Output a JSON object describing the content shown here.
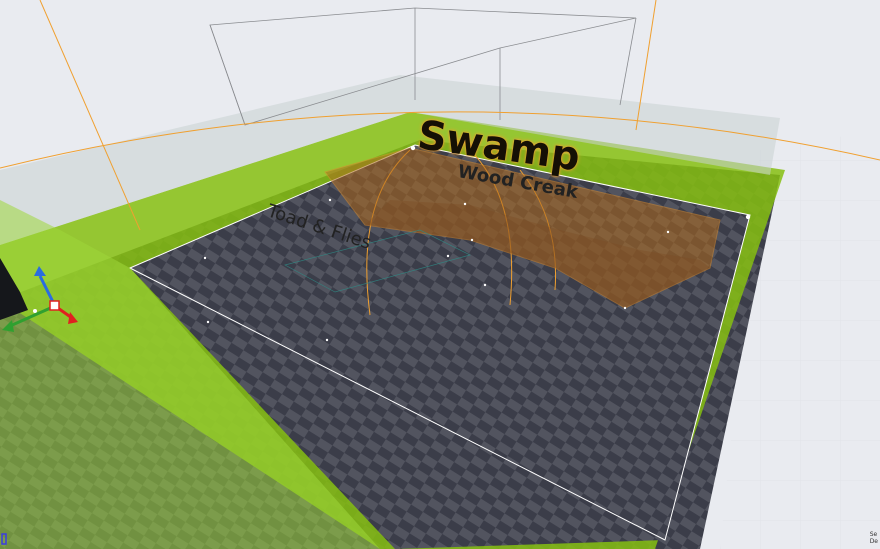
{
  "viewport": {
    "labels": {
      "swamp": "Swamp",
      "wood_creak": "Wood Creak",
      "toad_flies": "Toad &  Flies"
    },
    "corner_stats": [
      "Se",
      "De"
    ],
    "colors": {
      "background": "#e9ebf0",
      "floor_dark": "#3b3d49",
      "floor_light": "#52545f",
      "ambient_volume": "#86c010",
      "reverb_volume": "#b06a1c",
      "orange_line": "#f0a030",
      "gizmo_x": "#e02020",
      "gizmo_y": "#30a030",
      "gizmo_z": "#2a6ce0"
    },
    "icons": [
      "translate-gizmo-icon",
      "pivot-marker-icon"
    ]
  }
}
